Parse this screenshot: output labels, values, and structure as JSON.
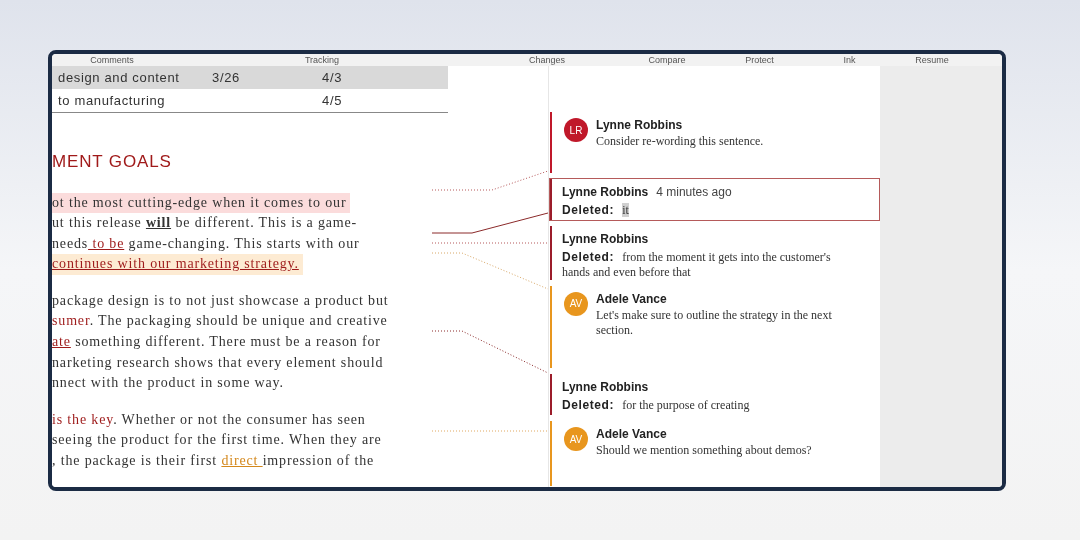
{
  "ribbon": {
    "groups": [
      "Comments",
      "Tracking",
      "Changes",
      "Compare",
      "Protect",
      "Ink",
      "Resume"
    ]
  },
  "table": {
    "rows": [
      {
        "cells": [
          "design and content",
          "3/26",
          "4/3"
        ],
        "shaded": true
      },
      {
        "cells": [
          "to manufacturing",
          null,
          "4/5"
        ],
        "shaded": false
      }
    ]
  },
  "heading": "MENT GOALS",
  "paragraphs": [
    {
      "lines": [
        {
          "highlighted": true,
          "color": "#fbdcdc",
          "segments": [
            {
              "kind": "plain",
              "text": "ot the most cutting-edge when it comes to our"
            }
          ]
        },
        {
          "highlighted": false,
          "segments": [
            {
              "kind": "plain",
              "text": "ut this release "
            },
            {
              "kind": "bold-underline",
              "text": "will"
            },
            {
              "kind": "plain",
              "text": " be different. This is a game-"
            }
          ]
        },
        {
          "highlighted": false,
          "segments": [
            {
              "kind": "plain",
              "text": "needs"
            },
            {
              "kind": "inserted",
              "text": " to be"
            },
            {
              "kind": "plain",
              "text": " game-changing. This starts with our"
            }
          ]
        },
        {
          "highlighted": true,
          "color": "#fdebd3",
          "segments": [
            {
              "kind": "inserted",
              "text": "continues with our marketing strategy."
            }
          ]
        }
      ]
    },
    {
      "lines": [
        {
          "highlighted": false,
          "segments": [
            {
              "kind": "plain",
              "text": "package design is to not just showcase a product but"
            }
          ]
        },
        {
          "highlighted": false,
          "segments": [
            {
              "kind": "emphasis",
              "text": "sumer"
            },
            {
              "kind": "plain",
              "text": ". The packaging should be unique and creative"
            }
          ]
        },
        {
          "highlighted": false,
          "segments": [
            {
              "kind": "inserted",
              "text": "ate"
            },
            {
              "kind": "plain",
              "text": " something different. There must be a reason for"
            }
          ]
        },
        {
          "highlighted": false,
          "segments": [
            {
              "kind": "plain",
              "text": "narketing research shows that every element should"
            }
          ]
        },
        {
          "highlighted": false,
          "segments": [
            {
              "kind": "plain",
              "text": "nnect with the product in some way."
            }
          ]
        }
      ]
    },
    {
      "lines": [
        {
          "highlighted": false,
          "segments": [
            {
              "kind": "emphasis",
              "text": "is the key"
            },
            {
              "kind": "plain",
              "text": ". Whether or not the consumer has seen"
            }
          ]
        },
        {
          "highlighted": false,
          "segments": [
            {
              "kind": "plain",
              "text": "seeing the product for the first time. When they are"
            }
          ]
        },
        {
          "highlighted": false,
          "segments": [
            {
              "kind": "plain",
              "text": ", the package is their first "
            },
            {
              "kind": "comment-insert",
              "text": "direct "
            },
            {
              "kind": "plain",
              "text": "impression of the"
            }
          ]
        }
      ]
    }
  ],
  "comments": [
    {
      "kind": "comment",
      "initials": "LR",
      "color": "#c0182a",
      "author": "Lynne Robbins",
      "text": "Consider re-wording this sentence.",
      "selected": false
    },
    {
      "kind": "revision",
      "color": "#9b1c2a",
      "author": "Lynne Robbins",
      "time": "4 minutes ago",
      "label": "Deleted:",
      "text": "it",
      "selected": true
    },
    {
      "kind": "revision",
      "color": "#9b1c2a",
      "author": "Lynne Robbins",
      "label": "Deleted:",
      "text": "from the moment it gets into the customer's hands and even before that",
      "selected": false
    },
    {
      "kind": "comment",
      "initials": "AV",
      "color": "#e8961e",
      "author": "Adele Vance",
      "text": "Let's make sure to outline the strategy in the next section.",
      "selected": false
    },
    {
      "kind": "revision",
      "color": "#9b1c2a",
      "author": "Lynne Robbins",
      "label": "Deleted:",
      "text": "for the purpose of creating",
      "selected": false
    },
    {
      "kind": "comment",
      "initials": "AV",
      "color": "#e8961e",
      "author": "Adele Vance",
      "text": "Should we mention something about demos?",
      "selected": false
    }
  ]
}
